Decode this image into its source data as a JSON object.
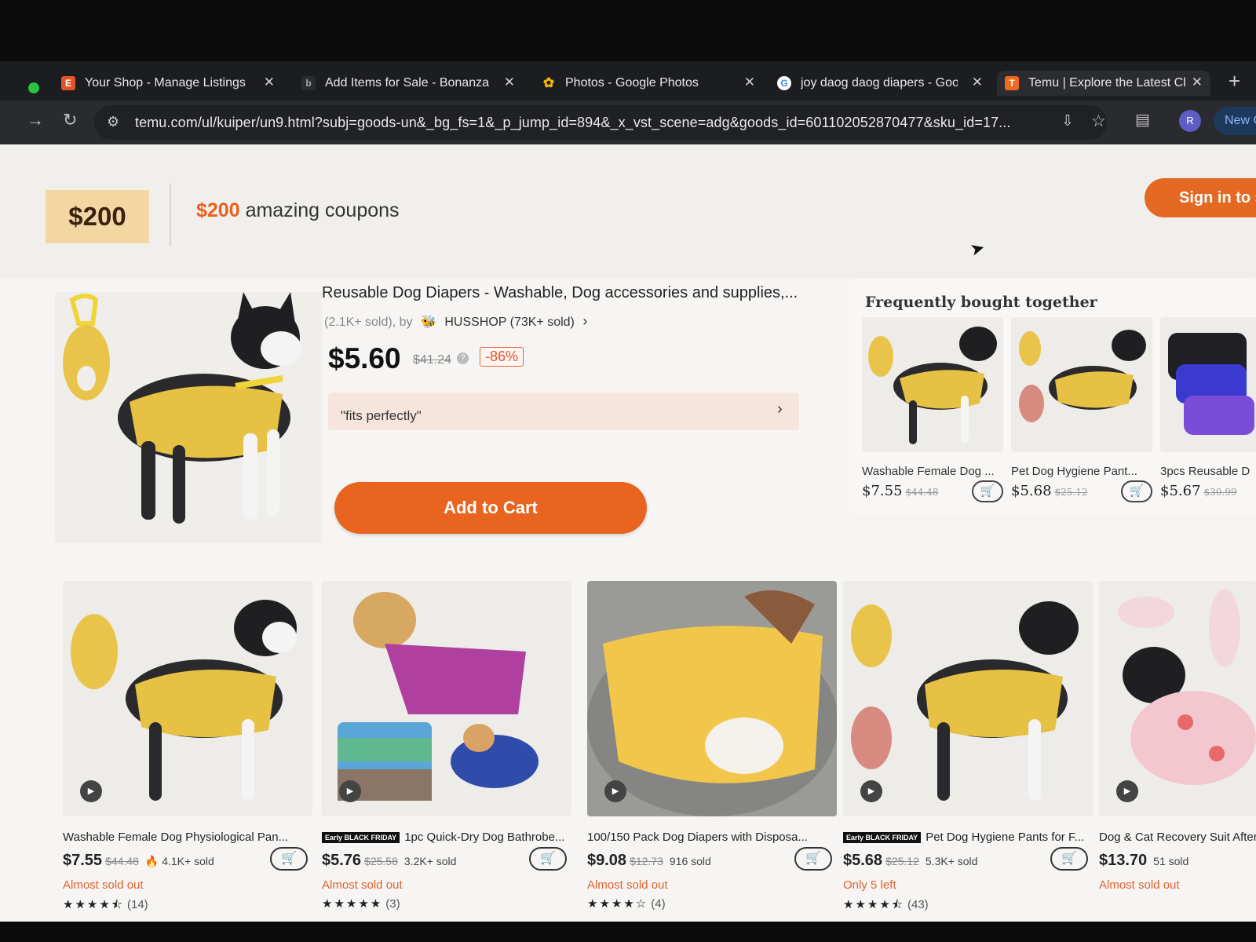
{
  "browser": {
    "tabs": [
      {
        "label": "Your Shop - Manage Listings",
        "favicon": "E",
        "favicon_color": "#e2552a"
      },
      {
        "label": "Add Items for Sale - Bonanza",
        "favicon": "b",
        "favicon_color": "#2b2c30"
      },
      {
        "label": "Photos - Google Photos",
        "favicon": "✿",
        "favicon_color": "#2b2c30"
      },
      {
        "label": "joy daog daog diapers - Goo",
        "favicon": "G",
        "favicon_color": "#ffffff"
      },
      {
        "label": "Temu | Explore the Latest Clo",
        "favicon": "T",
        "favicon_color": "#f06a1d"
      }
    ],
    "url": "temu.com/ul/kuiper/un9.html?subj=goods-un&_bg_fs=1&_p_jump_id=894&_x_vst_scene=adg&goods_id=601102052870477&sku_id=17...",
    "profile_initial": "R",
    "new_chrome_label": "New C"
  },
  "banner": {
    "coupon_amount": "$200",
    "coupon_amount_inline": "$200",
    "coupon_text": " amazing coupons",
    "signin_label": "Sign in to s"
  },
  "product": {
    "title": "Reusable Dog Diapers - Washable, Dog accessories and supplies,...",
    "sold": "(2.1K+ sold), by",
    "seller": "HUSSHOP (73K+ sold)",
    "price": "$5.60",
    "original_price": "$41.24",
    "discount": "-86%",
    "review_snippet": "\"fits perfectly\"",
    "add_to_cart": "Add to Cart"
  },
  "fbt": {
    "title": "Frequently bought together",
    "items": [
      {
        "name": "Washable Female Dog ...",
        "price": "$7.55",
        "orig": "$44.48"
      },
      {
        "name": "Pet Dog Hygiene Pant...",
        "price": "$5.68",
        "orig": "$25.12"
      },
      {
        "name": "3pcs Reusable D",
        "price": "$5.67",
        "orig": "$30.99"
      }
    ]
  },
  "grid": [
    {
      "name": "Washable Female Dog Physiological Pan...",
      "badge": "",
      "price": "$7.55",
      "orig": "$44.48",
      "sold": "🔥 4.1K+ sold",
      "stock": "Almost sold out",
      "stars": "★★★★⯪",
      "rating": 4.5,
      "count": "(14)"
    },
    {
      "name": "1pc Quick-Dry Dog Bathrobe...",
      "badge": "Early BLACK FRIDAY",
      "price": "$5.76",
      "orig": "$25.58",
      "sold": "3.2K+ sold",
      "stock": "Almost sold out",
      "stars": "★★★★★",
      "rating": 5,
      "count": "(3)"
    },
    {
      "name": "100/150 Pack Dog Diapers with Disposa...",
      "badge": "",
      "price": "$9.08",
      "orig": "$12.73",
      "sold": "916 sold",
      "stock": "Almost sold out",
      "stars": "★★★★☆",
      "rating": 4,
      "count": "(4)"
    },
    {
      "name": "Pet Dog Hygiene Pants for F...",
      "badge": "Early BLACK FRIDAY",
      "price": "$5.68",
      "orig": "$25.12",
      "sold": "5.3K+ sold",
      "stock": "Only 5 left",
      "stars": "★★★★⯪",
      "rating": 4.5,
      "count": "(43)"
    },
    {
      "name": "Dog & Cat Recovery Suit After Su",
      "badge": "",
      "price": "$13.70",
      "orig": "",
      "sold": "51 sold",
      "stock": "Almost sold out",
      "stars": "",
      "rating": null,
      "count": ""
    }
  ],
  "colors": {
    "accent": "#e8641f",
    "stock_red": "#e2622e",
    "coupon_gold": "#f2d7a2"
  }
}
